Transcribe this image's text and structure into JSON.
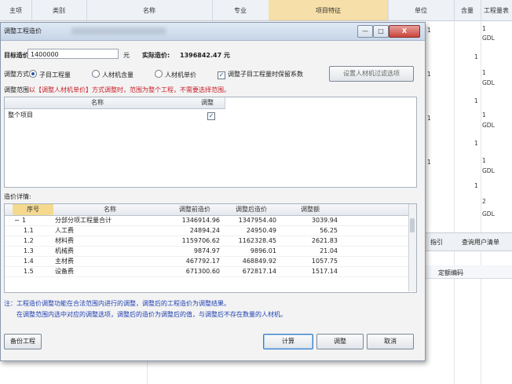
{
  "background": {
    "headers": [
      "主项",
      "类别",
      "名称",
      "专业",
      "项目特征",
      "单位",
      "含量",
      "工程量表"
    ],
    "unit_col": [
      "1",
      "GDL",
      "1",
      "GDL",
      "1",
      "GDL",
      "2",
      "GDL"
    ],
    "mid_col": [
      "1",
      "1",
      "1",
      "1",
      "1",
      "1",
      "1",
      "1",
      "1",
      "1",
      "1"
    ],
    "tab_partial": "指引",
    "tab_query": "查询用户清单",
    "code_label": "定额编码"
  },
  "dialog": {
    "title": "调整工程造价",
    "target_label": "目标造价:",
    "target_value": "1400000",
    "target_unit": "元",
    "actual_label": "实际造价:",
    "actual_value": "1396842.47 元",
    "method_label": "调整方式:",
    "methods": [
      "子目工程量",
      "人材机含量",
      "人材机单价"
    ],
    "keep_checkbox": "调整子目工程量时保留系数",
    "set_button": "设置人材机过滤选项",
    "scope_label": "调整范围:",
    "scope_note": "以【调整人材机单价】方式调整时，范围为整个工程，不需要选择范围。",
    "scope_grid": {
      "headers": [
        "名称",
        "调整"
      ],
      "row_name": "整个项目",
      "row_check": "✓"
    },
    "detail_label": "造价详情:",
    "detail_grid": {
      "headers": [
        "序号",
        "名称",
        "调整前造价",
        "调整后造价",
        "调整额"
      ],
      "rows": [
        {
          "no": "1",
          "name": "分部分项工程量合计",
          "before": "1346914.96",
          "after": "1347954.40",
          "diff": "3039.94",
          "expander": "−"
        },
        {
          "no": "1.1",
          "name": "人工费",
          "before": "24894.24",
          "after": "24950.49",
          "diff": "56.25",
          "expander": ""
        },
        {
          "no": "1.2",
          "name": "材料费",
          "before": "1159706.62",
          "after": "1162328.45",
          "diff": "2621.83",
          "expander": ""
        },
        {
          "no": "1.3",
          "name": "机械费",
          "before": "9874.97",
          "after": "9896.01",
          "diff": "21.04",
          "expander": ""
        },
        {
          "no": "1.4",
          "name": "主材费",
          "before": "467792.17",
          "after": "468849.92",
          "diff": "1057.75",
          "expander": ""
        },
        {
          "no": "1.5",
          "name": "设备费",
          "before": "671300.60",
          "after": "672817.14",
          "diff": "1517.14",
          "expander": ""
        }
      ]
    },
    "note_prefix": "注：",
    "note1": "工程造价调整功能在合法范围内进行的调整，调整后的工程造价为调整结果。",
    "note2": "在调整范围内选中对应的调整选项，调整后的造价为调整后的值，与调整后不存在数量的人材机。",
    "buttons": {
      "backup": "备份工程",
      "calc": "计算",
      "adjust": "调整",
      "cancel": "取消"
    },
    "window_buttons": {
      "min": "—",
      "max": "□",
      "close": "X"
    }
  },
  "colors": {
    "accent": "#2a57a8",
    "header_highlight": "#f6dfa8",
    "note": "#1f3fb0",
    "warning": "#c8202a"
  }
}
